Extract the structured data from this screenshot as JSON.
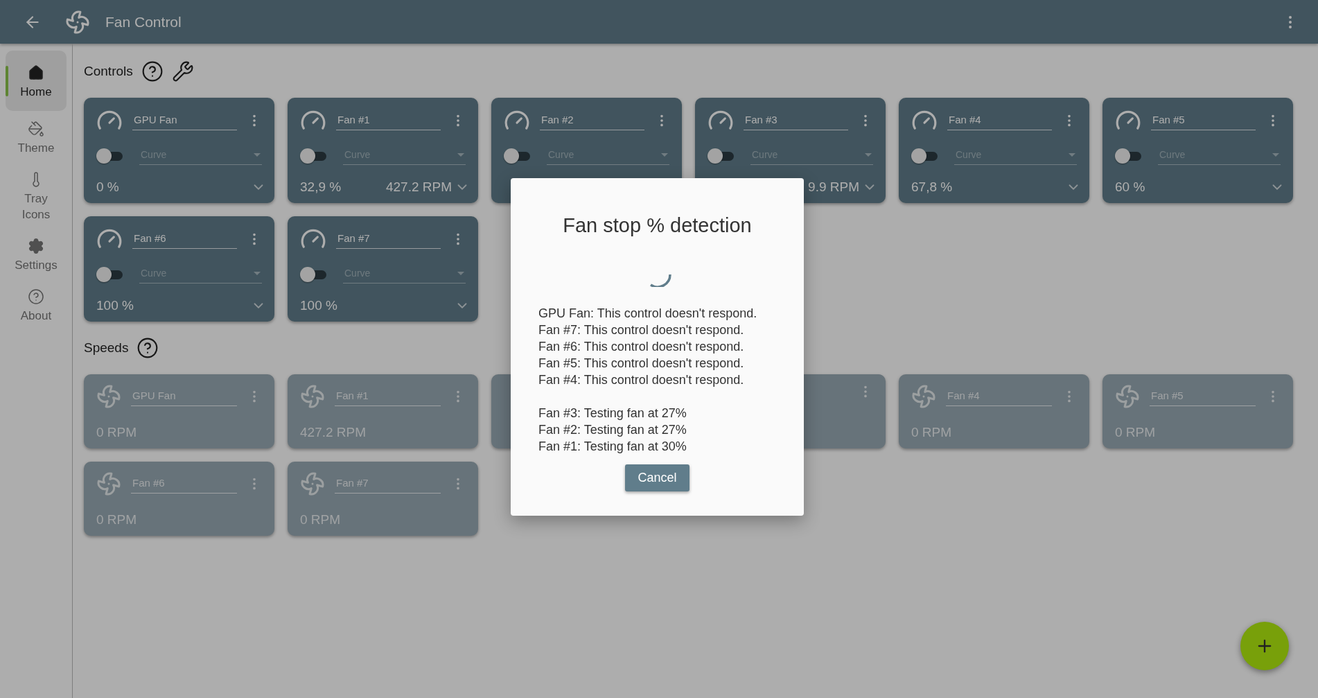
{
  "app_bar": {
    "title": "Fan Control"
  },
  "nav": [
    {
      "label": "Home",
      "selected": true
    },
    {
      "label": "Theme",
      "selected": false
    },
    {
      "label": "Tray Icons",
      "selected": false
    },
    {
      "label": "Settings",
      "selected": false
    },
    {
      "label": "About",
      "selected": false
    }
  ],
  "controls": {
    "title": "Controls",
    "items": [
      {
        "name": "GPU Fan",
        "on": false,
        "curve_placeholder": "Curve",
        "percent": "0 %"
      },
      {
        "name": "Fan #1",
        "on": false,
        "curve_placeholder": "Curve",
        "percent": "32,9 %",
        "rpm": "427.2 RPM"
      },
      {
        "name": "Fan #2",
        "on": false,
        "curve_placeholder": "Curve"
      },
      {
        "name": "Fan #3",
        "on": false,
        "curve_placeholder": "Curve",
        "rpm": "9.9 RPM"
      },
      {
        "name": "Fan #4",
        "on": false,
        "curve_placeholder": "Curve",
        "percent": "67,8 %"
      },
      {
        "name": "Fan #5",
        "on": false,
        "curve_placeholder": "Curve",
        "percent": "60 %"
      },
      {
        "name": "Fan #6",
        "on": false,
        "curve_placeholder": "Curve",
        "percent": "100 %"
      },
      {
        "name": "Fan #7",
        "on": false,
        "curve_placeholder": "Curve",
        "percent": "100 %"
      }
    ]
  },
  "speeds": {
    "title": "Speeds",
    "items": [
      {
        "kind": "sensor",
        "name": "GPU Fan",
        "rpm": "0 RPM"
      },
      {
        "kind": "sensor",
        "name": "Fan #1",
        "rpm": "427.2 RPM"
      },
      {
        "kind": "covered"
      },
      {
        "kind": "covered"
      },
      {
        "kind": "sensor",
        "name": "Fan #4",
        "rpm": "0 RPM"
      },
      {
        "kind": "sensor",
        "name": "Fan #5",
        "rpm": "0 RPM"
      },
      {
        "kind": "sensor",
        "name": "Fan #6",
        "rpm": "0 RPM"
      },
      {
        "kind": "sensor",
        "name": "Fan #7",
        "rpm": "0 RPM"
      }
    ]
  },
  "dialog": {
    "title": "Fan stop % detection",
    "failed": [
      "GPU Fan: This control doesn't respond.",
      "Fan #7: This control doesn't respond.",
      "Fan #6: This control doesn't respond.",
      "Fan #5: This control doesn't respond.",
      "Fan #4: This control doesn't respond."
    ],
    "testing": [
      "Fan #3: Testing fan at 27%",
      "Fan #2: Testing fan at 27%",
      "Fan #1: Testing fan at 30%"
    ],
    "button": "Cancel"
  }
}
